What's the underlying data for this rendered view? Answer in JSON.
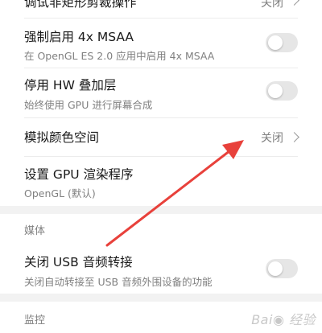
{
  "items": {
    "top_partial": {
      "title": "调试非矩形剪裁操作",
      "value": "关闭"
    },
    "msaa": {
      "title": "强制启用 4x MSAA",
      "subtitle": "在 OpenGL ES 2.0 应用中启用 4x MSAA",
      "enabled": false
    },
    "hw_overlay": {
      "title": "停用 HW 叠加层",
      "subtitle": "始终使用 GPU 进行屏幕合成",
      "enabled": false
    },
    "color_space": {
      "title": "模拟颜色空间",
      "value": "关闭"
    },
    "gpu_renderer": {
      "title": "设置 GPU 渲染程序",
      "subtitle": "OpenGL (默认)"
    }
  },
  "sections": {
    "media": {
      "label": "媒体",
      "usb_audio": {
        "title": "关闭 USB 音频转接",
        "subtitle": "关闭自动转接至 USB 音频外围设备的功能",
        "enabled": false
      }
    },
    "monitoring": {
      "label": "监控"
    }
  },
  "annotation": {
    "color": "#e8413b"
  },
  "watermark": "Bai 经验"
}
